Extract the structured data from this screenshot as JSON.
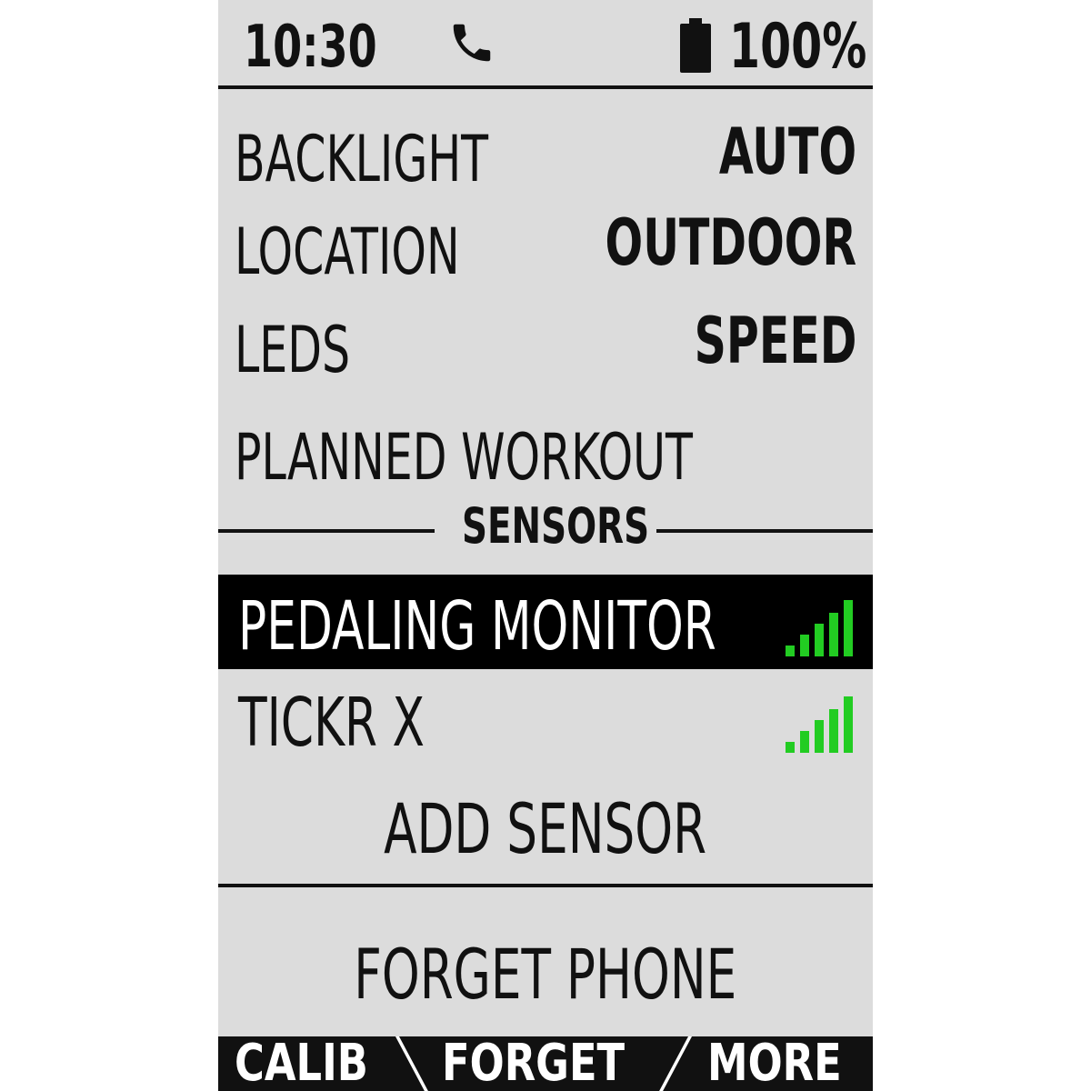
{
  "status_bar": {
    "time": "10:30",
    "phone_icon": "phone-icon",
    "battery_icon": "battery-full-icon",
    "battery_percent": "100%"
  },
  "settings": [
    {
      "label": "BACKLIGHT",
      "value": "AUTO"
    },
    {
      "label": "LOCATION",
      "value": "OUTDOOR"
    },
    {
      "label": "LEDS",
      "value": "SPEED"
    },
    {
      "label": "PLANNED WORKOUT",
      "value": ""
    }
  ],
  "sensors_section": {
    "title": "SENSORS",
    "items": [
      {
        "name": "PEDALING MONITOR",
        "signal_icon": "signal-strength-icon",
        "signal_level": 5,
        "selected": true
      },
      {
        "name": "TICKR X",
        "signal_icon": "signal-strength-icon",
        "signal_level": 5,
        "selected": false
      }
    ],
    "add_label": "ADD SENSOR"
  },
  "forget_phone_label": "FORGET PHONE",
  "softkeys": {
    "left": "CALIB",
    "center": "FORGET",
    "right": "MORE"
  },
  "colors": {
    "screen_background": "#dcdcdc",
    "text": "#111111",
    "selected_row_background": "#000000",
    "selected_row_text": "#ffffff",
    "signal": "#22cc22",
    "softkey_bar": "#111111"
  }
}
